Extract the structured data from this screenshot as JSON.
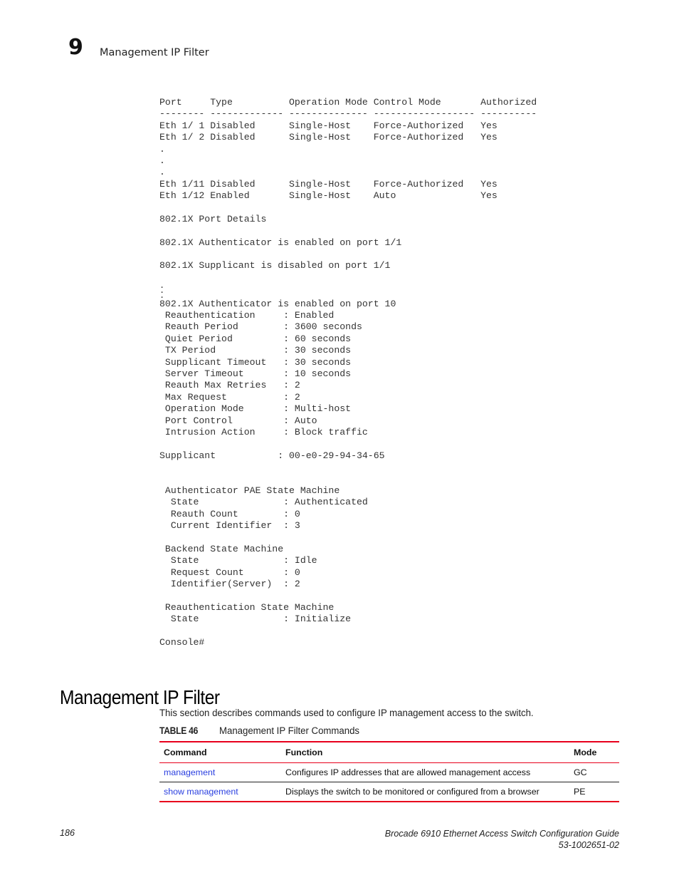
{
  "header": {
    "chapter_number": "9",
    "chapter_title": "Management IP Filter"
  },
  "code_block": {
    "lines": [
      "Port     Type          Operation Mode Control Mode       Authorized",
      "-------- ------------- -------------- ------------------ ----------",
      "Eth 1/ 1 Disabled      Single-Host    Force-Authorized   Yes",
      "Eth 1/ 2 Disabled      Single-Host    Force-Authorized   Yes",
      ".",
      ".",
      ".",
      "Eth 1/11 Disabled      Single-Host    Force-Authorized   Yes",
      "Eth 1/12 Enabled       Single-Host    Auto               Yes",
      "",
      "802.1X Port Details",
      "",
      "802.1X Authenticator is enabled on port 1/1",
      "",
      "802.1X Supplicant is disabled on port 1/1",
      "",
      ".",
      ".",
      ".",
      "802.1X Authenticator is enabled on port 10",
      " Reauthentication     : Enabled",
      " Reauth Period        : 3600 seconds",
      " Quiet Period         : 60 seconds",
      " TX Period            : 30 seconds",
      " Supplicant Timeout   : 30 seconds",
      " Server Timeout       : 10 seconds",
      " Reauth Max Retries   : 2",
      " Max Request          : 2",
      " Operation Mode       : Multi-host",
      " Port Control         : Auto",
      " Intrusion Action     : Block traffic",
      "",
      "Supplicant           : 00-e0-29-94-34-65",
      "",
      "",
      " Authenticator PAE State Machine",
      "  State               : Authenticated",
      "  Reauth Count        : 0",
      "  Current Identifier  : 3",
      "",
      " Backend State Machine",
      "  State               : Idle",
      "  Request Count       : 0",
      "  Identifier(Server)  : 2",
      "",
      " Reauthentication State Machine",
      "  State               : Initialize",
      "",
      "Console#"
    ]
  },
  "section": {
    "title": "Management IP Filter",
    "intro": "This section describes commands used to configure IP management access to the switch."
  },
  "table": {
    "number_label": "TABLE 46",
    "caption": "Management IP Filter Commands",
    "columns": [
      "Command",
      "Function",
      "Mode"
    ],
    "rows": [
      {
        "command": "management",
        "function": "Configures IP addresses that are allowed management access",
        "mode": "GC"
      },
      {
        "command": "show management",
        "function": "Displays the switch to be monitored or configured from a browser",
        "mode": "PE"
      }
    ],
    "accent_color": "#e8001c",
    "link_color": "#2a3fe0"
  },
  "footer": {
    "page_number": "186",
    "doc_title": "Brocade 6910 Ethernet Access Switch Configuration Guide",
    "doc_id": "53-1002651-02"
  }
}
